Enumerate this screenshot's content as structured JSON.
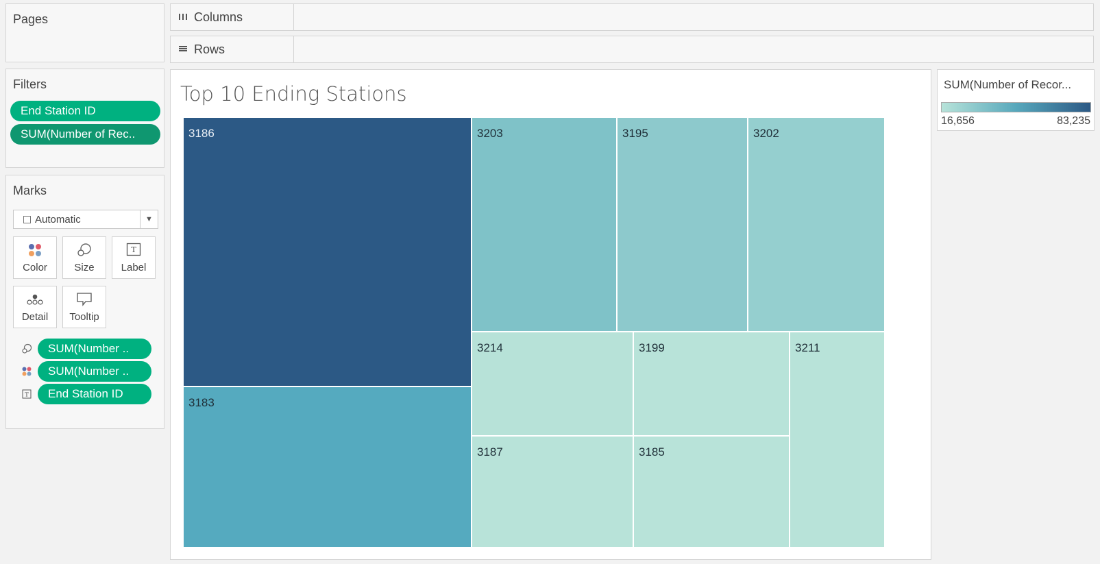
{
  "cards": {
    "pages_title": "Pages",
    "filters_title": "Filters",
    "marks_title": "Marks",
    "filters": [
      "End Station ID",
      "SUM(Number of Rec.."
    ],
    "marks_type": "Automatic",
    "mark_buttons": [
      "Color",
      "Size",
      "Label",
      "Detail",
      "Tooltip"
    ],
    "mark_fields": [
      {
        "icon": "size-icon",
        "label": "SUM(Number .."
      },
      {
        "icon": "color-icon",
        "label": "SUM(Number .."
      },
      {
        "icon": "label-icon",
        "label": "End Station ID"
      }
    ]
  },
  "shelves": {
    "columns_label": "Columns",
    "rows_label": "Rows"
  },
  "viz": {
    "title": "Top 10 Ending Stations"
  },
  "legend": {
    "title": "SUM(Number of Recor...",
    "min_label": "16,656",
    "max_label": "83,235",
    "min_color": "#b7e3d9",
    "max_color": "#2c5985"
  },
  "chart_data": {
    "type": "treemap",
    "title": "Top 10 Ending Stations",
    "measure": "SUM(Number of Records)",
    "dimension": "End Station ID",
    "color_range": [
      16656,
      83235
    ],
    "items": [
      {
        "label": "3186",
        "value": 83235,
        "color": "#2c5985",
        "text_color": "#e8eef5"
      },
      {
        "label": "3183",
        "value": 43000,
        "color": "#55aabf",
        "text_color": "#1f2f38"
      },
      {
        "label": "3203",
        "value": 27000,
        "color": "#7fc2c8",
        "text_color": "#1f2f38"
      },
      {
        "label": "3195",
        "value": 24500,
        "color": "#8dc9cc",
        "text_color": "#1f2f38"
      },
      {
        "label": "3202",
        "value": 22000,
        "color": "#95cfcf",
        "text_color": "#1f2f38"
      },
      {
        "label": "3214",
        "value": 18000,
        "color": "#b7e2d8",
        "text_color": "#1f2f38"
      },
      {
        "label": "3199",
        "value": 17300,
        "color": "#b8e3d9",
        "text_color": "#1f2f38"
      },
      {
        "label": "3187",
        "value": 17100,
        "color": "#b8e3d9",
        "text_color": "#1f2f38"
      },
      {
        "label": "3185",
        "value": 16700,
        "color": "#b8e3d9",
        "text_color": "#1f2f38"
      },
      {
        "label": "3211",
        "value": 16656,
        "color": "#b8e3d9",
        "text_color": "#1f2f38"
      }
    ]
  }
}
